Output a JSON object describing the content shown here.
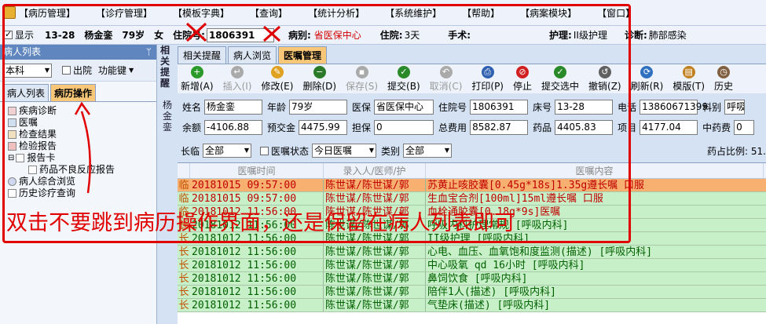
{
  "menu": [
    "【病历管理】",
    "【诊疗管理】",
    "【模板字典】",
    "【查询】",
    "【统计分析】",
    "【系统维护】",
    "【帮助】",
    "【病案模块】",
    "【窗口】"
  ],
  "info": {
    "show": "显示",
    "bed": "13-28",
    "name": "杨金銮",
    "age": "79岁",
    "sex": "女",
    "inp_label": "住院号:",
    "inp_no": "1806391",
    "ward_label": "病别:",
    "ward": "省医保中心",
    "stay_label": "住院:",
    "stay": "3天",
    "surgery": "手术:",
    "nursing_label": "护理:",
    "nursing": "II级护理",
    "diag_label": "诊断:",
    "diag": "肺部感染"
  },
  "left": {
    "title": "病人列表",
    "pin": "ᛘ",
    "dept": "本科",
    "discharge": "出院",
    "func": "功能键",
    "tabs": [
      "病人列表",
      "病历操作"
    ],
    "tree": [
      "疾病诊断",
      "医嘱",
      "检查结果",
      "检验报告",
      "报告卡",
      "药品不良反应报告",
      "病人综合浏览",
      "历史诊疗查询"
    ]
  },
  "vlabel": "相关提醒",
  "vlabel2": "杨金銮",
  "tabs": [
    "相关提醒",
    "病人浏览",
    "医嘱管理"
  ],
  "toolbar": [
    {
      "l": "新增(A)",
      "c": "#2a9a2a",
      "g": "+"
    },
    {
      "l": "插入(I)",
      "c": "#aaa",
      "g": "↵",
      "d": true
    },
    {
      "l": "修改(E)",
      "c": "#e0a020",
      "g": "✎"
    },
    {
      "l": "删除(D)",
      "c": "#2a7a2a",
      "g": "−"
    },
    {
      "l": "保存(S)",
      "c": "#aaa",
      "g": "▪",
      "d": true
    },
    {
      "l": "提交(B)",
      "c": "#2a8a2a",
      "g": "✓"
    },
    {
      "l": "取消(C)",
      "c": "#aaa",
      "g": "↶",
      "d": true
    },
    {
      "l": "打印(P)",
      "c": "#3060b0",
      "g": "⎙"
    },
    {
      "l": "停止",
      "c": "#d02020",
      "g": "⊘"
    },
    {
      "l": "提交选中",
      "c": "#2a8a2a",
      "g": "✓"
    },
    {
      "l": "撤销(Z)",
      "c": "#606060",
      "g": "↺"
    },
    {
      "l": "刷新(R)",
      "c": "#3070c0",
      "g": "⟳"
    },
    {
      "l": "模版(T)",
      "c": "#c08020",
      "g": "▤"
    },
    {
      "l": "历史",
      "c": "#806040",
      "g": "◷"
    }
  ],
  "form": {
    "name_l": "姓名",
    "name": "杨金銮",
    "age_l": "年龄",
    "age": "79岁",
    "ins_l": "医保",
    "ins": "省医保中心",
    "inp_l": "住院号",
    "inp": "1806391",
    "bed_l": "床号",
    "bed": "13-28",
    "tel_l": "电话",
    "tel": "13860671399",
    "dept_l": "科别",
    "dept": "呼吸",
    "bal_l": "余额",
    "bal": "-4106.88",
    "pre_l": "预交金",
    "pre": "4475.99",
    "gua_l": "担保",
    "gua": "0",
    "tot_l": "总费用",
    "tot": "8582.87",
    "drug_l": "药品",
    "drug": "4405.83",
    "item_l": "项目",
    "item": "4177.04",
    "herb_l": "中药费",
    "herb": "0"
  },
  "filter": {
    "long_l": "长临",
    "long": "全部",
    "status_l": "医嘱状态",
    "status": "今日医嘱",
    "type_l": "类别",
    "type": "全部",
    "ratio": "药占比例: 51."
  },
  "grid": {
    "head": [
      "医嘱时间",
      "录入人/医师/护",
      "医嘱内容"
    ],
    "rows": [
      {
        "m": "临",
        "t": "20181015 09:57:00",
        "p": "陈世谋/陈世谋/郭",
        "c": "苏黄止咳胶囊[0.45g*18s]1.35g遵长嘱 口服",
        "k": "sel"
      },
      {
        "m": "临",
        "t": "20181015 09:57:00",
        "p": "陈世谋/陈世谋/郭",
        "c": "生血宝合剂[100ml]15ml遵长嘱 口服",
        "k": "red"
      },
      {
        "m": "临",
        "t": "20181012 11:56:00",
        "p": "陈世谋/陈世谋/郭",
        "c": "血栓通胶囊[0.18g*9s]医嘱",
        "k": "red"
      },
      {
        "m": "长",
        "t": "20181012 11:56:00",
        "p": "陈世谋/陈世谋/郭",
        "c": "呼吸内科护理常规  [呼吸内科]",
        "k": ""
      },
      {
        "m": "长",
        "t": "20181012 11:56:00",
        "p": "陈世谋/陈世谋/郭",
        "c": "II级护理  [呼吸内科]",
        "k": ""
      },
      {
        "m": "长",
        "t": "20181012 11:56:00",
        "p": "陈世谋/陈世谋/郭",
        "c": "心电、血压、血氧饱和度监测(描述)  [呼吸内科]",
        "k": ""
      },
      {
        "m": "长",
        "t": "20181012 11:56:00",
        "p": "陈世谋/陈世谋/郭",
        "c": "中心吸氧 qd 16小时  [呼吸内科]",
        "k": ""
      },
      {
        "m": "长",
        "t": "20181012 11:56:00",
        "p": "陈世谋/陈世谋/郭",
        "c": "鼻饲饮食  [呼吸内科]",
        "k": ""
      },
      {
        "m": "长",
        "t": "20181012 11:56:00",
        "p": "陈世谋/陈世谋/郭",
        "c": "陪伴1人(描述)  [呼吸内科]",
        "k": ""
      },
      {
        "m": "长",
        "t": "20181012 11:56:00",
        "p": "陈世谋/陈世谋/郭",
        "c": "气垫床(描述)  [呼吸内科]",
        "k": ""
      }
    ]
  },
  "annotation": "双击不要跳到病历操作界面，还是保留在病人列表即可",
  "colors": {
    "accent": "#f8c878",
    "annotation": "#e00000",
    "long_row": "#c8f0c8",
    "selected_row": "#f8b070"
  }
}
